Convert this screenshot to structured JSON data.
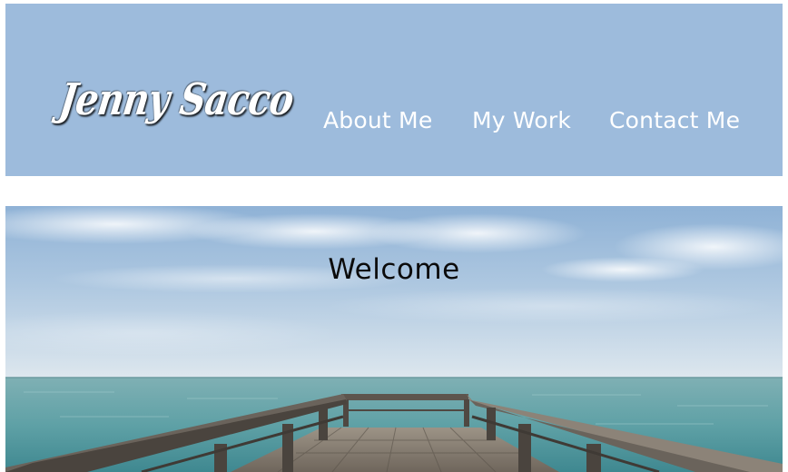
{
  "header": {
    "logo_text": "Jenny Sacco",
    "background_color": "#9dbbdc",
    "nav": [
      {
        "label": "About Me"
      },
      {
        "label": "My Work"
      },
      {
        "label": "Contact Me"
      }
    ]
  },
  "hero": {
    "heading": "Welcome",
    "image_icon": "pier-over-sea-image"
  }
}
